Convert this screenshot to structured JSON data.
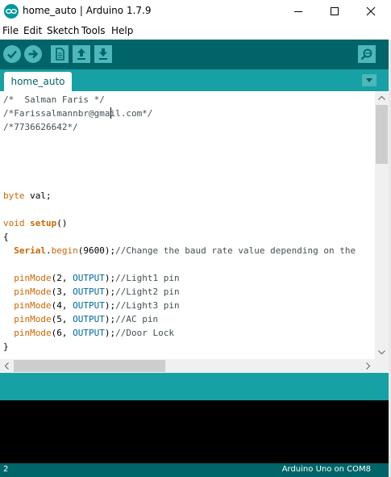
{
  "window": {
    "title": "home_auto | Arduino 1.7.9",
    "icons": [
      "arduino-logo-icon",
      "minimize-icon",
      "maximize-icon",
      "close-icon"
    ]
  },
  "menu": [
    "File",
    "Edit",
    "Sketch",
    "Tools",
    "Help"
  ],
  "toolbar": {
    "icons": [
      "verify-icon",
      "upload-icon",
      "new-icon",
      "open-icon",
      "save-icon",
      "serial-monitor-icon"
    ]
  },
  "tabs": [
    {
      "label": "home_auto"
    }
  ],
  "code": [
    [
      {
        "t": "/*  Salman Faris */",
        "c": "comment"
      }
    ],
    [
      {
        "t": "/*Farissalmannbr@gmail.com*/",
        "c": "comment"
      }
    ],
    [
      {
        "t": "/*7736626642*/",
        "c": "comment"
      }
    ],
    [],
    [],
    [],
    [],
    [
      {
        "t": "byte",
        "c": "kw"
      },
      {
        "t": " val;",
        "c": ""
      }
    ],
    [],
    [
      {
        "t": "void",
        "c": "kw"
      },
      {
        "t": " ",
        "c": ""
      },
      {
        "t": "setup",
        "c": "kwb"
      },
      {
        "t": "()",
        "c": ""
      }
    ],
    [
      {
        "t": "{",
        "c": ""
      }
    ],
    [
      {
        "t": "  ",
        "c": ""
      },
      {
        "t": "Serial",
        "c": "kwb"
      },
      {
        "t": ".",
        "c": ""
      },
      {
        "t": "begin",
        "c": "kw"
      },
      {
        "t": "(9600);",
        "c": ""
      },
      {
        "t": "//Change the baud rate value depending on the",
        "c": "comment"
      }
    ],
    [],
    [
      {
        "t": "  ",
        "c": ""
      },
      {
        "t": "pinMode",
        "c": "kw"
      },
      {
        "t": "(2, ",
        "c": ""
      },
      {
        "t": "OUTPUT",
        "c": "const"
      },
      {
        "t": ");",
        "c": ""
      },
      {
        "t": "//Light1 pin",
        "c": "comment"
      }
    ],
    [
      {
        "t": "  ",
        "c": ""
      },
      {
        "t": "pinMode",
        "c": "kw"
      },
      {
        "t": "(3, ",
        "c": ""
      },
      {
        "t": "OUTPUT",
        "c": "const"
      },
      {
        "t": ");",
        "c": ""
      },
      {
        "t": "//Light2 pin",
        "c": "comment"
      }
    ],
    [
      {
        "t": "  ",
        "c": ""
      },
      {
        "t": "pinMode",
        "c": "kw"
      },
      {
        "t": "(4, ",
        "c": ""
      },
      {
        "t": "OUTPUT",
        "c": "const"
      },
      {
        "t": ");",
        "c": ""
      },
      {
        "t": "//Light3 pin",
        "c": "comment"
      }
    ],
    [
      {
        "t": "  ",
        "c": ""
      },
      {
        "t": "pinMode",
        "c": "kw"
      },
      {
        "t": "(5, ",
        "c": ""
      },
      {
        "t": "OUTPUT",
        "c": "const"
      },
      {
        "t": ");",
        "c": ""
      },
      {
        "t": "//AC pin",
        "c": "comment"
      }
    ],
    [
      {
        "t": "  ",
        "c": ""
      },
      {
        "t": "pinMode",
        "c": "kw"
      },
      {
        "t": "(6, ",
        "c": ""
      },
      {
        "t": "OUTPUT",
        "c": "const"
      },
      {
        "t": ");",
        "c": ""
      },
      {
        "t": "//Door Lock",
        "c": "comment"
      }
    ],
    [
      {
        "t": "}",
        "c": ""
      }
    ]
  ],
  "status": {
    "line_number": "2",
    "board": "Arduino Uno on COM8"
  },
  "colors": {
    "toolbar": "#006468",
    "tabbar": "#17a1a5",
    "button": "#4db7bb",
    "keyword": "#cc6600",
    "constant": "#006699",
    "comment": "#434f54"
  }
}
